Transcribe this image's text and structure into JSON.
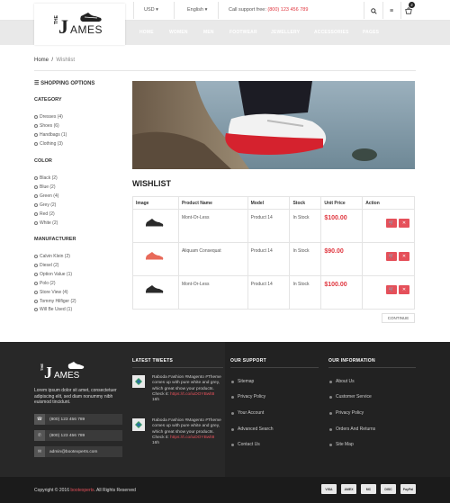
{
  "topbar": {
    "currency": "USD",
    "language": "English",
    "support_label": "Call support free:",
    "support_phone": "(800) 123 456 789",
    "cart_count": "2"
  },
  "logo": {
    "letter": "J",
    "the": "THE",
    "rest": "AMES"
  },
  "nav": [
    "HOME",
    "WOMEN",
    "MEN",
    "FOOTWEAR",
    "JEWELLERY",
    "ACCESSORIES",
    "PAGES"
  ],
  "breadcrumb": {
    "home": "Home",
    "sep": "/",
    "current": "Wishlist"
  },
  "sidebar": {
    "title": "SHOPPING OPTIONS",
    "category": {
      "heading": "CATEGORY",
      "items": [
        "Dresses (4)",
        "Shoes (6)",
        "Handbags (1)",
        "Clothing (3)"
      ]
    },
    "color": {
      "heading": "COLOR",
      "items": [
        "Black (2)",
        "Blue (2)",
        "Green (4)",
        "Grey (2)",
        "Red (2)",
        "White (2)"
      ]
    },
    "manufacturer": {
      "heading": "MANUFACTURER",
      "items": [
        "Calvin Klein (2)",
        "Diesel (2)",
        "Option Value (1)",
        "Polo (2)",
        "Store View (4)",
        "Tommy Hilfiger (2)",
        "Will Be Used (1)"
      ]
    }
  },
  "wishlist": {
    "title": "WISHLIST",
    "columns": [
      "Image",
      "Product Name",
      "Model",
      "Stock",
      "Unit Price",
      "Action"
    ],
    "rows": [
      {
        "name": "Mont-Or-Less",
        "model": "Product 14",
        "stock": "In Stock",
        "price": "$100.00",
        "shoe_color": "#2a2a2a"
      },
      {
        "name": "Aliquam Consequat",
        "model": "Product 14",
        "stock": "In Stock",
        "price": "$90.00",
        "shoe_color": "#e86a5a"
      },
      {
        "name": "Mont-Or-Less",
        "model": "Product 14",
        "stock": "In Stock",
        "price": "$100.00",
        "shoe_color": "#2a2a2a"
      }
    ],
    "continue_label": "CONTINUE"
  },
  "footer": {
    "about": "Lorem ipsum dolor sit amet, consectetuer adipiscing elit, sed diam nonummy nibh euismod tincidunt.",
    "contacts": [
      {
        "icon": "phone-icon",
        "text": "(800) 123 456 789"
      },
      {
        "icon": "fax-icon",
        "text": "(800) 123 456 789"
      },
      {
        "icon": "mail-icon",
        "text": "admin@bootexperts.com"
      }
    ],
    "latest_tweets": {
      "heading": "LATEST TWEETS",
      "tweets": [
        {
          "text": "Raboda Fashion #Magento #Theme comes up with pure white and grey, which great show your products. Check it:",
          "link": "https://t.co/iuDOYBwlt8",
          "time": "16h"
        },
        {
          "text": "Raboda Fashion #Magento #Theme comes up with pure white and grey, which great show your products. Check it:",
          "link": "https://t.co/iuDOYBwlt8",
          "time": "16h"
        }
      ]
    },
    "our_support": {
      "heading": "OUR SUPPORT",
      "links": [
        "Sitemap",
        "Privacy Policy",
        "Your Account",
        "Advanced Search",
        "Contact Us"
      ]
    },
    "our_information": {
      "heading": "OUR INFORMATION",
      "links": [
        "About Us",
        "Customer Service",
        "Privacy Policy",
        "Orders And Returns",
        "Site Map"
      ]
    },
    "copyright_pre": "Copyright © 2016",
    "copyright_brand": "bootexperts",
    "copyright_post": ". All Rights Reserved",
    "payments": [
      "VISA",
      "AMEX",
      "MC",
      "DISC",
      "PayPal"
    ]
  },
  "colors": {
    "accent": "#e5505a",
    "price": "#e0363f",
    "footer": "#282828"
  }
}
